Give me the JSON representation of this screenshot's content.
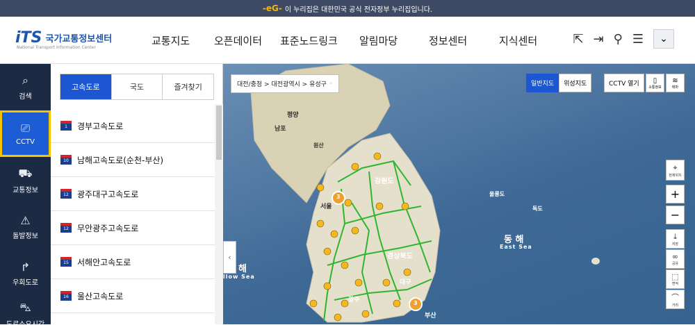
{
  "gov_bar": {
    "emblem": "-eG-",
    "text": "이 누리집은 대한민국 공식 전자정부 누리집입니다."
  },
  "logo": {
    "mark": "iTS",
    "title": "국가교통정보센터",
    "subtitle": "National Transport Information Center"
  },
  "gnb": [
    "교통지도",
    "오픈데이터",
    "표준노드링크",
    "알림마당",
    "정보센터",
    "지식센터"
  ],
  "util_icons": [
    "external-link-icon",
    "login-icon",
    "user-icon",
    "menu-icon",
    "chevron-down-icon"
  ],
  "leftnav": [
    {
      "label": "검색",
      "icon": "search-icon",
      "active": false
    },
    {
      "label": "CCTV",
      "icon": "cctv-icon",
      "active": true
    },
    {
      "label": "교통정보",
      "icon": "car-icon",
      "active": false
    },
    {
      "label": "돌발정보",
      "icon": "alert-icon",
      "active": false
    },
    {
      "label": "우회도로",
      "icon": "detour-icon",
      "active": false
    },
    {
      "label": "도로소요시간",
      "icon": "bus-icon",
      "active": false
    }
  ],
  "tabs": [
    "고속도로",
    "국도",
    "즐겨찾기"
  ],
  "highways": [
    {
      "num": "1",
      "name": "경부고속도로"
    },
    {
      "num": "10",
      "name": "남해고속도로(순천-부산)"
    },
    {
      "num": "12",
      "name": "광주대구고속도로"
    },
    {
      "num": "12",
      "name": "무안광주고속도로"
    },
    {
      "num": "15",
      "name": "서해안고속도로"
    },
    {
      "num": "16",
      "name": "울산고속도로"
    }
  ],
  "map": {
    "breadcrumb": "대전/충청 > 대전광역시 > 유성구",
    "map_types": [
      "일반지도",
      "위성지도"
    ],
    "cctv_open": "CCTV 열기",
    "tools": [
      {
        "label": "소통정보"
      },
      {
        "label": "테마"
      }
    ],
    "right_tools": [
      {
        "label": "현재위치",
        "icon": "crosshair-icon"
      },
      {
        "label": "저장",
        "icon": "download-icon"
      },
      {
        "label": "공유",
        "icon": "share-icon"
      },
      {
        "label": "면적",
        "icon": "area-icon"
      },
      {
        "label": "거리",
        "icon": "ruler-icon"
      }
    ],
    "zoom_in": "+",
    "zoom_out": "−",
    "sea_labels": {
      "east_kr": "동 해",
      "east_en": "East Sea",
      "west_kr": "해",
      "west_en": "llow Sea"
    },
    "place_labels": [
      "평양",
      "남포",
      "강원도",
      "울릉도",
      "독도",
      "경상북도",
      "대구",
      "부산",
      "광주",
      "서울",
      "원산"
    ],
    "cluster_counts": [
      "3",
      "3"
    ]
  }
}
